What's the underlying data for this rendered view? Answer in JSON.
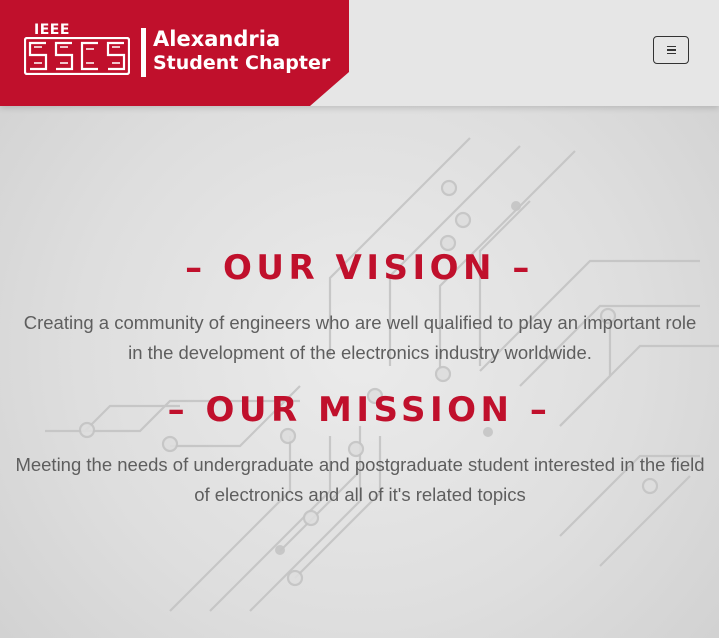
{
  "header": {
    "logo": {
      "org": "IEEE",
      "acronym": "SSCS",
      "line1": "Alexandria",
      "line2": "Student Chapter"
    },
    "menu_icon": "hamburger-menu-icon"
  },
  "vision": {
    "heading": "– OUR VISION –",
    "text": "Creating a community of engineers who are well qualified to play an important role in the development of the electronics industry worldwide."
  },
  "mission": {
    "heading": "– OUR MISSION –",
    "text": "Meeting the needs of undergraduate and postgraduate student interested in the field of electronics and all of it's related topics"
  },
  "colors": {
    "brand_red": "#c0102c",
    "navbar_bg": "#e6e6e6",
    "text_gray": "#5e5e5e"
  }
}
